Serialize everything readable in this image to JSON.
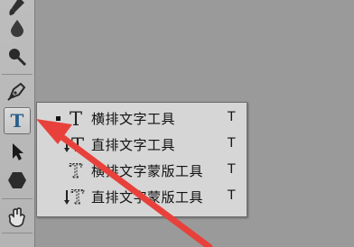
{
  "toolbar": {
    "tools": [
      {
        "name": "brush-icon"
      },
      {
        "name": "blur-icon"
      },
      {
        "name": "dodge-icon"
      },
      {
        "name": "pen-icon"
      },
      {
        "name": "text-tool-icon",
        "label": "T",
        "active": true
      },
      {
        "name": "path-selection-icon"
      },
      {
        "name": "shape-icon"
      },
      {
        "name": "hand-icon"
      }
    ]
  },
  "flyout": {
    "items": [
      {
        "label": "横排文字工具",
        "shortcut": "T",
        "selected": true,
        "icon": "horizontal-type-icon",
        "glyph": "T"
      },
      {
        "label": "直排文字工具",
        "shortcut": "T",
        "selected": false,
        "icon": "vertical-type-icon",
        "glyph": "T"
      },
      {
        "label": "横排文字蒙版工具",
        "shortcut": "T",
        "selected": false,
        "icon": "horizontal-type-mask-icon",
        "glyph": "T"
      },
      {
        "label": "直排文字蒙版工具",
        "shortcut": "T",
        "selected": false,
        "icon": "vertical-type-mask-icon",
        "glyph": "T"
      }
    ]
  },
  "colors": {
    "arrow": "#e8413b",
    "active_tool_glyph": "#2a5e8c"
  }
}
